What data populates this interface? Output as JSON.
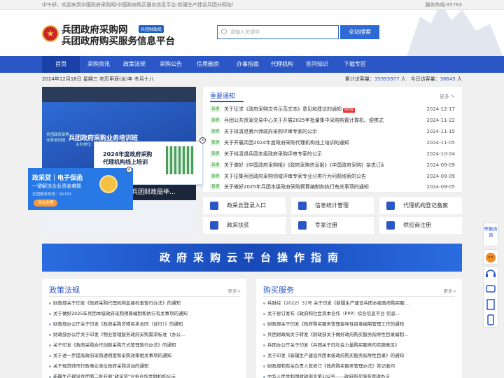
{
  "topbar": {
    "welcome": "中午好，欢迎来到中国政府采购网/中国政府购买服务信息平台-新疆生产建设兵团分网站!",
    "hotline": "服务热线:95763"
  },
  "header": {
    "title1": "兵团政府采购网",
    "title2": "兵团政府购买服务信息平台",
    "badge": "兵团财政局",
    "search_placeholder": "请输入关键字",
    "search_button": "全站搜索"
  },
  "nav": [
    "首页",
    "采购资讯",
    "政策法规",
    "采购公告",
    "信用融资",
    "办事指南",
    "代理机构",
    "答问知识",
    "下载专区"
  ],
  "date": "2024年12月18日 星期三 农历甲辰(龙)年 冬月十八",
  "visits": {
    "total_label": "累计访客量：",
    "total": "35993977",
    "unit1": "人",
    "today_label": "今日访客量：",
    "today": "38645",
    "unit2": "人"
  },
  "banner": {
    "screen_title": "兵团政府采购业务培训班",
    "caption": "兵团财政局举...",
    "left_lines": [
      "兵团政府采购",
      "业务培训班",
      "主办单位：兵团财政局"
    ]
  },
  "popup_ad": {
    "title1": "2024年度政府采购",
    "title2": "代理机构线上培训"
  },
  "left_ad": {
    "title": "政采贷｜电子保函",
    "subtitle": "一键解决企业资金难题",
    "hotline": "全国服务热线：95763",
    "button": "点击办理"
  },
  "notices": {
    "title": "重要通知",
    "more": "更多 >",
    "tag": "普通",
    "new_label": "NEW",
    "items": [
      {
        "text": "关于征求《政府采购文件示范文本》意见和建议的通知",
        "date": "2024-12-17",
        "isnew": true
      },
      {
        "text": "兵团公共资源交易中心关于开展2025年批量集中采购购置计算机、便携式计算机框架协...",
        "date": "2024-11-22"
      },
      {
        "text": "关于拟清退第六师政府采购评审专家的公示",
        "date": "2024-11-15"
      },
      {
        "text": "关于开展兵团2024年度政府采购代理机构线上培训的通知",
        "date": "2024-11-05"
      },
      {
        "text": "关于拟清退兵团本级政府采购评审专家的公示",
        "date": "2024-10-24"
      },
      {
        "text": "关于做好《中国政府采购报》《政府采购信息报》《中国政府采购》杂志订阅工作的通知",
        "date": "2024-09-09"
      },
      {
        "text": "关于征集兵团政府采购领域评审专家专业分类行为问题线索的公告",
        "date": "2024-09-09"
      },
      {
        "text": "关于做好2025年兵团本级政府采购预算编制和执行有关事项的通知",
        "date": "2024-09-05"
      }
    ]
  },
  "quick": [
    "政采云登录入口",
    "信息统计管理",
    "代理机构登记备案",
    "政采扶贫",
    "专家注册",
    "供应商注册"
  ],
  "guide_banner": "政府采购云平台操作指南",
  "policy": {
    "title": "政策法规",
    "more": "更多>",
    "items": [
      "财政部关于印发《政府采购代理机构监督检查暂行办法》的通知",
      "关于做好2025年兵团本级政府采购预算编制和执行有关事项的通知",
      "财政部办公厅关于印发《政府采购货物买卖合同（试行）》的通知",
      "财政部办公厅关于印发《物业管理服务政府采购需求标准（办公...",
      "关于印发《政府采购合作创新采购方式管理暂行办法》的通知",
      "关于进一步提高政府采购透明度和采购效率相关事项的通知",
      "关于规范师市行政事业单位政府采购活动的通知",
      "新疆生产建设兵团第二批开展\"政采贷\"业务合作金融机构公示"
    ]
  },
  "purchase": {
    "title": "购买服务",
    "more": "更多>",
    "items": [
      "兵财综〔2022〕31号 关于印发《新疆生产建设兵团本级政府购买服...",
      "关于修订发布《政府和社会资本合作（PPP）综合信息平台 信息...",
      "财政部关于印发《政府购买服务管理指导性目录编制管理工作的通知",
      "兵团财政局关于转发《财政部关于做好政府购买服务指导性目录编制...",
      "兵团办公厅关于印发《兵团关于向社会力量购买服务的实施意见》",
      "关于印发《新疆生产建设兵团本级政府购买服务指导性目录》的通知",
      "财政部和有关负责人就修订《政府购买服务管理办法》答记者问",
      "中华人民共和国财政部令第102号——政府购买服务管理办法"
    ]
  },
  "side": {
    "report": "举报咨询"
  }
}
